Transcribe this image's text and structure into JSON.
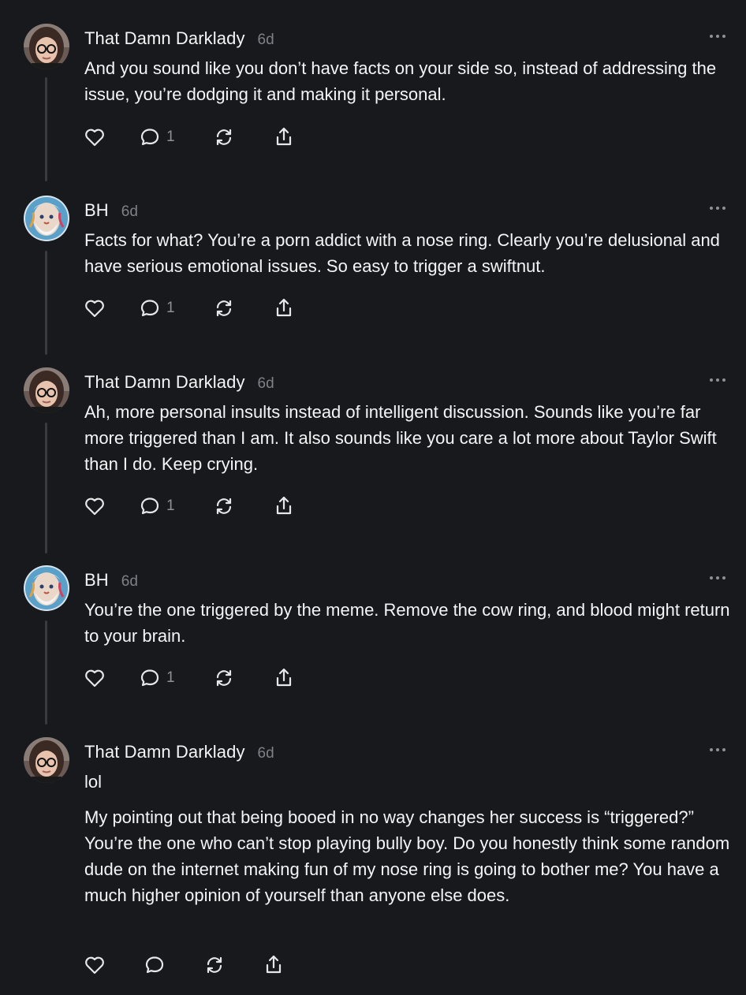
{
  "posts": [
    {
      "author": "That Damn Darklady",
      "time": "6d",
      "avatar": "avatar-woman-glasses",
      "paragraphs": [
        "And you sound like you don’t have facts on your side so, instead of addressing the issue, you’re dodging it and making it personal."
      ],
      "reply_count": "1"
    },
    {
      "author": "BH",
      "time": "6d",
      "avatar": "avatar-painted-face",
      "paragraphs": [
        "Facts for what? You’re a porn addict with a nose ring. Clearly you’re delusional and have serious emotional issues. So easy to trigger a swiftnut."
      ],
      "reply_count": "1"
    },
    {
      "author": "That Damn Darklady",
      "time": "6d",
      "avatar": "avatar-woman-glasses",
      "paragraphs": [
        "Ah, more personal insults instead of intelligent discussion. Sounds like you’re far more triggered than I am. It also sounds like you care a lot more about Taylor Swift than I do. Keep crying."
      ],
      "reply_count": "1"
    },
    {
      "author": "BH",
      "time": "6d",
      "avatar": "avatar-painted-face",
      "paragraphs": [
        "You’re the one triggered by the meme. Remove the cow ring, and blood might return to your brain."
      ],
      "reply_count": "1"
    },
    {
      "author": "That Damn Darklady",
      "time": "6d",
      "avatar": "avatar-woman-glasses",
      "paragraphs": [
        "lol",
        "My pointing out that being booed in no way changes her success is “triggered?” You’re the one who can’t stop playing bully boy. Do you honestly think some random dude on the internet making fun of my nose ring is going to bother me? You have a much higher opinion of yourself than anyone else does."
      ],
      "reply_count": ""
    }
  ],
  "icons": {
    "like": "heart-icon",
    "reply": "comment-icon",
    "repost": "repost-icon",
    "share": "share-icon",
    "more": "more-icon"
  },
  "colors": {
    "background": "#18191c",
    "text": "#f3f5f7",
    "secondary": "#7f8187",
    "thread_line": "#3a3b3f"
  }
}
